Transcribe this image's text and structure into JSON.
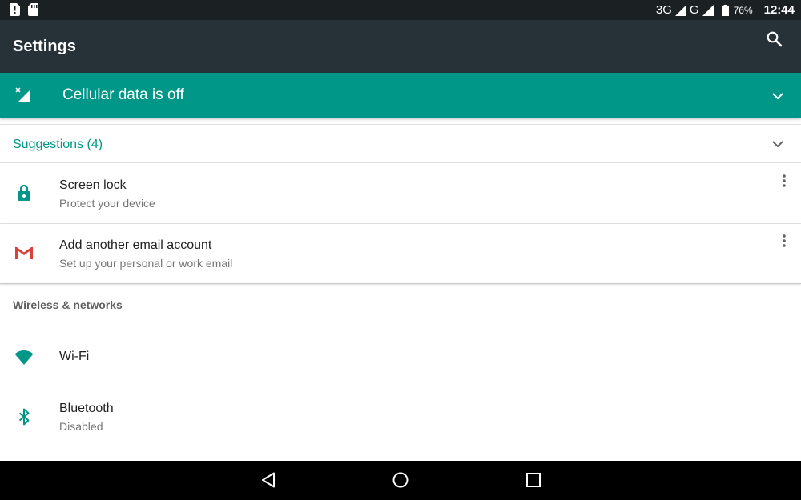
{
  "status_bar": {
    "network_3g": "3G",
    "network_g": "G",
    "battery": "76%",
    "time": "12:44"
  },
  "app_bar": {
    "title": "Settings",
    "search_icon": "search-icon"
  },
  "banner": {
    "text": "Cellular data is off",
    "icon": "cellular-off-icon",
    "color": "#009688"
  },
  "suggestions": {
    "header": "Suggestions (4)",
    "items": [
      {
        "title": "Screen lock",
        "subtitle": "Protect your device",
        "icon": "lock-icon"
      },
      {
        "title": "Add another email account",
        "subtitle": "Set up your personal or work email",
        "icon": "gmail-icon"
      }
    ]
  },
  "wireless": {
    "category": "Wireless & networks",
    "items": [
      {
        "title": "Wi-Fi",
        "subtitle": "",
        "icon": "wifi-icon"
      },
      {
        "title": "Bluetooth",
        "subtitle": "Disabled",
        "icon": "bluetooth-icon"
      }
    ]
  },
  "colors": {
    "accent": "#009688",
    "app_bar": "#263238",
    "status_bar": "#1b2022"
  }
}
